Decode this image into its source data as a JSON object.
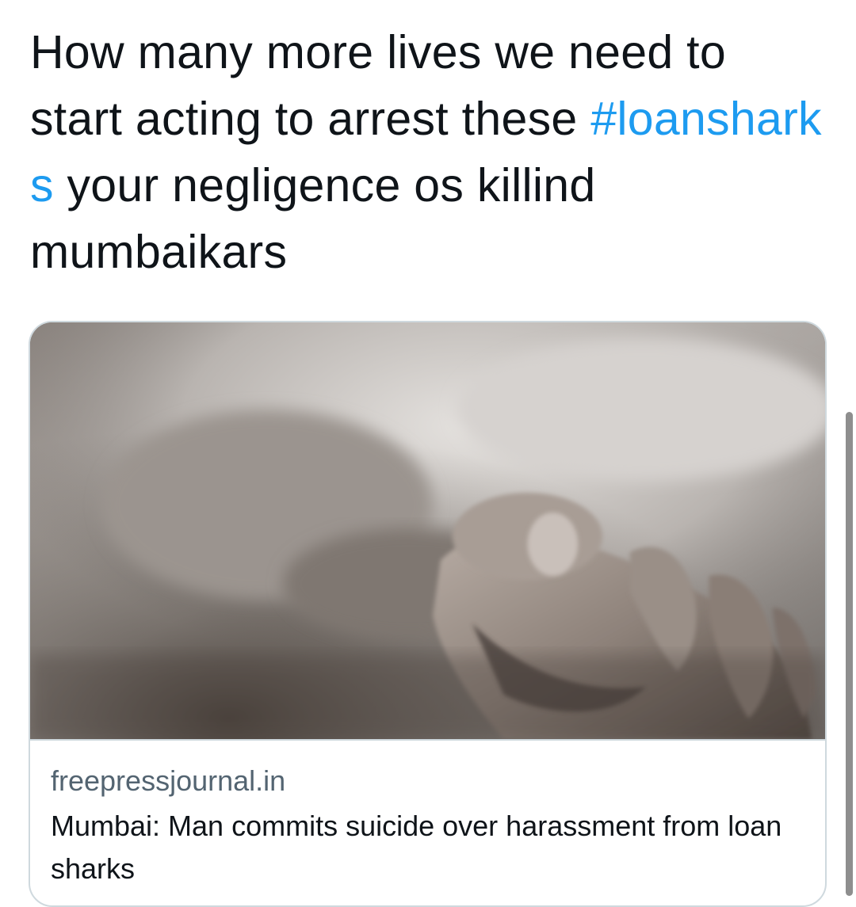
{
  "tweet": {
    "text_before": "How many more lives we need to start acting to arrest these ",
    "hashtag": "#loanshark s",
    "text_after": " your negligence os killind mumbaikars"
  },
  "link_card": {
    "image_icon": "hand-photo-icon",
    "domain": "freepressjournal.in",
    "title": "Mumbai: Man commits suicide over harassment from loan sharks"
  },
  "colors": {
    "hashtag": "#1d9bf0",
    "text": "#0f1419",
    "secondary_text": "#536471",
    "card_border": "#cfd9de",
    "scrollbar_thumb": "#8e8e8e"
  }
}
